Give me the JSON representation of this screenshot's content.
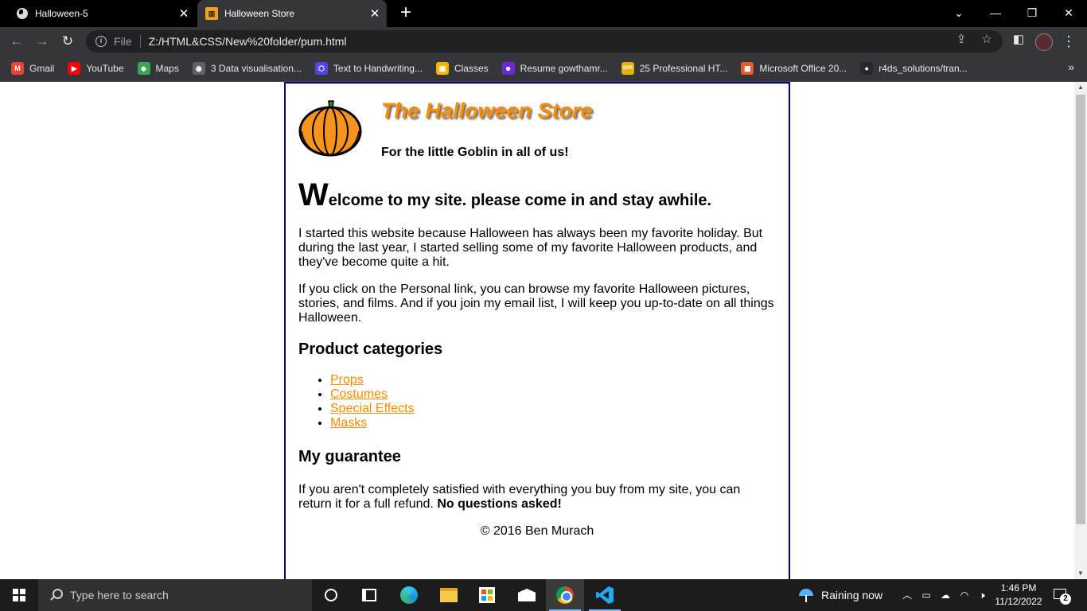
{
  "browser": {
    "tabs": [
      {
        "title": "Halloween-5",
        "active": false
      },
      {
        "title": "Halloween Store",
        "active": true
      }
    ],
    "url_scheme_label": "File",
    "url": "Z:/HTML&CSS/New%20folder/pum.html",
    "bookmarks": [
      {
        "label": "Gmail",
        "icon": "gmail-icon",
        "color": "#ea4335",
        "glyph": "M"
      },
      {
        "label": "YouTube",
        "icon": "youtube-icon",
        "color": "#ff0000",
        "glyph": "▶"
      },
      {
        "label": "Maps",
        "icon": "maps-icon",
        "color": "#34a853",
        "glyph": "◆"
      },
      {
        "label": "3 Data visualisation...",
        "icon": "globe-icon",
        "color": "#5f6368",
        "glyph": "◉"
      },
      {
        "label": "Text to Handwriting...",
        "icon": "hexagon-icon",
        "color": "#4f46e5",
        "glyph": "⬡"
      },
      {
        "label": "Classes",
        "icon": "classroom-icon",
        "color": "#f4b400",
        "glyph": "▣"
      },
      {
        "label": "Resume gowthamr...",
        "icon": "resume-icon",
        "color": "#6d28d9",
        "glyph": "☻"
      },
      {
        "label": "25 Professional HT...",
        "icon": "sdr-icon",
        "color": "#e3b008",
        "glyph": "SDR"
      },
      {
        "label": "Microsoft Office 20...",
        "icon": "office-icon",
        "color": "#e35d2b",
        "glyph": "▦"
      },
      {
        "label": "r4ds_solutions/tran...",
        "icon": "github-icon",
        "color": "#24292e",
        "glyph": "●"
      }
    ]
  },
  "page": {
    "store_title": "The Halloween Store",
    "tagline": "For the little Goblin in all of us!",
    "welcome_dropcap": "W",
    "welcome_rest": "elcome to my site. please come in and stay awhile.",
    "paragraphs": [
      "I started this website because Halloween has always been my favorite holiday. But during the last year, I started selling some of my favorite Halloween products, and they've become quite a hit.",
      "If you click on the Personal link, you can browse my favorite Halloween pictures, stories, and films. And if you join my email list, I will keep you up-to-date on all things Halloween."
    ],
    "categories_heading": "Product categories",
    "categories": [
      "Props",
      "Costumes",
      "Special Effects",
      "Masks"
    ],
    "guarantee_heading": "My guarantee",
    "guarantee_text": "If you aren't completely satisfied with everything you buy from my site, you can return it for a full refund.",
    "guarantee_bold": "No questions asked!",
    "copyright": "© 2016 Ben Murach",
    "accent_color": "#ff8c00",
    "border_color": "#000080"
  },
  "taskbar": {
    "search_placeholder": "Type here to search",
    "weather": "Raining now",
    "time": "1:46 PM",
    "date": "11/12/2022",
    "notifications": "2"
  }
}
